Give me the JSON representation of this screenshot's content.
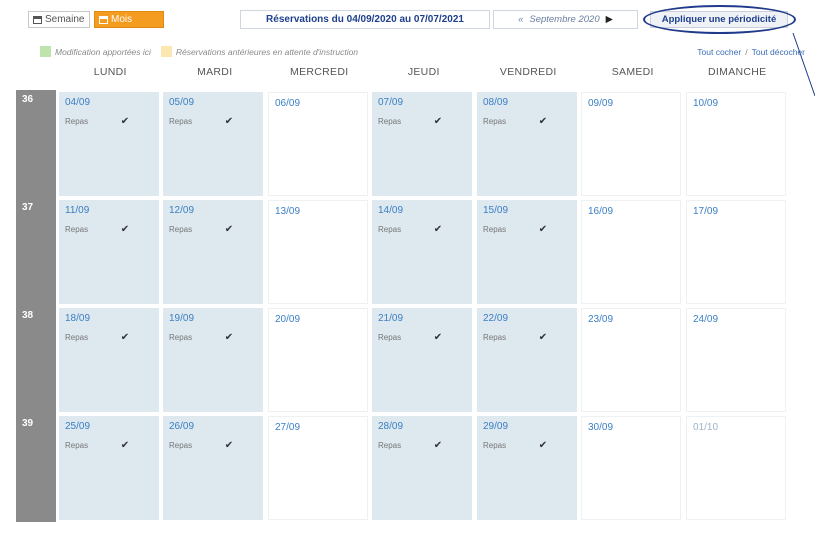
{
  "toolbar": {
    "semaine_label": "Semaine",
    "mois_label": "Mois",
    "period_title": "Réservations du 04/09/2020 au 07/07/2021",
    "prev_arrow": "«",
    "month_label": "Septembre 2020",
    "next_arrow": "▶",
    "apply_periodicity_label": "Appliquer une périodicité"
  },
  "legend": {
    "modified_label": "Modification apportées ici",
    "pending_label": "Réservations antérieures en attente d'instruction",
    "colors": {
      "modified": "#bfe3ad",
      "pending": "#fde7b0"
    }
  },
  "links": {
    "check_all": "Tout cocher",
    "separator": "/",
    "uncheck_all": "Tout décocher"
  },
  "days": [
    "LUNDI",
    "MARDI",
    "MERCREDI",
    "JEUDI",
    "VENDREDI",
    "SAMEDI",
    "DIMANCHE"
  ],
  "meal_label": "Repas",
  "weeks": [
    {
      "num": "36",
      "cells": [
        {
          "date": "04/09",
          "meal": true
        },
        {
          "date": "05/09",
          "meal": true
        },
        {
          "date": "06/09",
          "meal": false
        },
        {
          "date": "07/09",
          "meal": true
        },
        {
          "date": "08/09",
          "meal": true
        },
        {
          "date": "09/09",
          "meal": false
        },
        {
          "date": "10/09",
          "meal": false
        }
      ]
    },
    {
      "num": "37",
      "cells": [
        {
          "date": "11/09",
          "meal": true
        },
        {
          "date": "12/09",
          "meal": true
        },
        {
          "date": "13/09",
          "meal": false
        },
        {
          "date": "14/09",
          "meal": true
        },
        {
          "date": "15/09",
          "meal": true
        },
        {
          "date": "16/09",
          "meal": false
        },
        {
          "date": "17/09",
          "meal": false
        }
      ]
    },
    {
      "num": "38",
      "cells": [
        {
          "date": "18/09",
          "meal": true
        },
        {
          "date": "19/09",
          "meal": true
        },
        {
          "date": "20/09",
          "meal": false
        },
        {
          "date": "21/09",
          "meal": true
        },
        {
          "date": "22/09",
          "meal": true
        },
        {
          "date": "23/09",
          "meal": false
        },
        {
          "date": "24/09",
          "meal": false
        }
      ]
    },
    {
      "num": "39",
      "cells": [
        {
          "date": "25/09",
          "meal": true
        },
        {
          "date": "26/09",
          "meal": true
        },
        {
          "date": "27/09",
          "meal": false
        },
        {
          "date": "28/09",
          "meal": true
        },
        {
          "date": "29/09",
          "meal": true
        },
        {
          "date": "30/09",
          "meal": false
        },
        {
          "date": "01/10",
          "meal": false,
          "other_month": true
        }
      ]
    }
  ]
}
